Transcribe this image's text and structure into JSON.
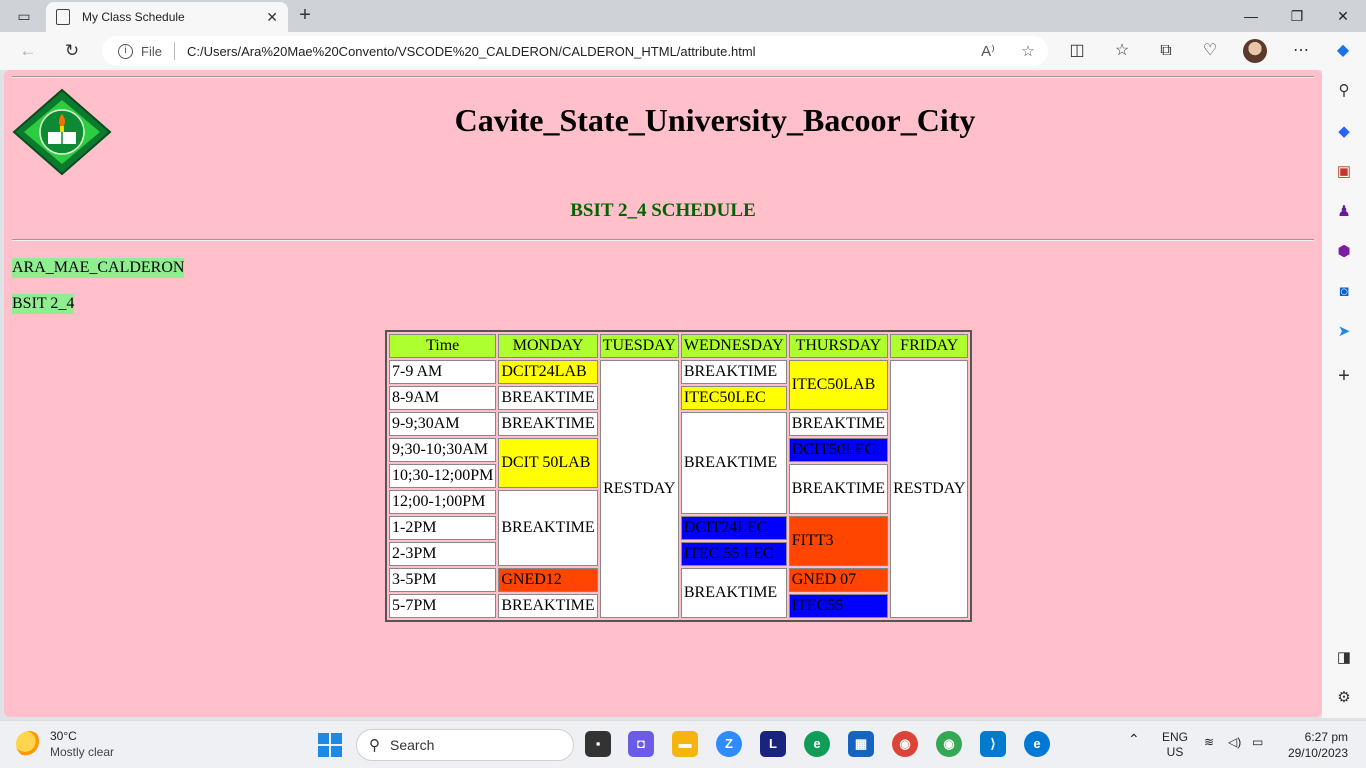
{
  "browser": {
    "tab_title": "My Class Schedule",
    "file_label": "File",
    "url": "C:/Users/Ara%20Mae%20Convento/VSCODE%20_CALDERON/CALDERON_HTML/attribute.html"
  },
  "page": {
    "site_title": "Cavite_State_University_Bacoor_City",
    "schedule_title": "BSIT 2_4 SCHEDULE",
    "student_name": "ARA_MAE_CALDERON",
    "section": "BSIT 2_4"
  },
  "table": {
    "headers": [
      "Time",
      "MONDAY",
      "TUESDAY",
      "WEDNESDAY",
      "THURSDAY",
      "FRIDAY"
    ],
    "times": [
      "7-9 AM",
      "8-9AM",
      "9-9;30AM",
      "9;30-10;30AM",
      "10;30-12;00PM",
      "12;00-1;00PM",
      "1-2PM",
      "2-3PM",
      "3-5PM",
      "5-7PM"
    ],
    "monday": [
      "DCIT24LAB",
      "BREAKTIME",
      "BREAKTIME",
      "DCIT 50LAB",
      "BREAKTIME",
      "GNED12",
      "BREAKTIME"
    ],
    "tuesday": "RESTDAY",
    "wednesday": [
      "BREAKTIME",
      "ITEC50LEC",
      "BREAKTIME",
      "DCIT24LEC",
      "ITEC 55 LEC",
      "BREAKTIME"
    ],
    "thursday": [
      "ITEC50LAB",
      "BREAKTIME",
      "DCIT50LEC",
      "BREAKTIME",
      "FITT3",
      "GNED 07",
      "ITEC55"
    ],
    "friday": "RESTDAY"
  },
  "colors": {
    "page_bg": "#ffc0cb",
    "header_bg": "#adff2f",
    "yellow": "#ffff00",
    "blue": "#0000ff",
    "orange": "#ff4500",
    "schedule_title": "#006400",
    "name_bg": "#90ee90"
  },
  "taskbar": {
    "temperature": "30°C",
    "weather": "Mostly clear",
    "search_placeholder": "Search",
    "lang_line1": "ENG",
    "lang_line2": "US",
    "time": "6:27 pm",
    "date": "29/10/2023"
  }
}
